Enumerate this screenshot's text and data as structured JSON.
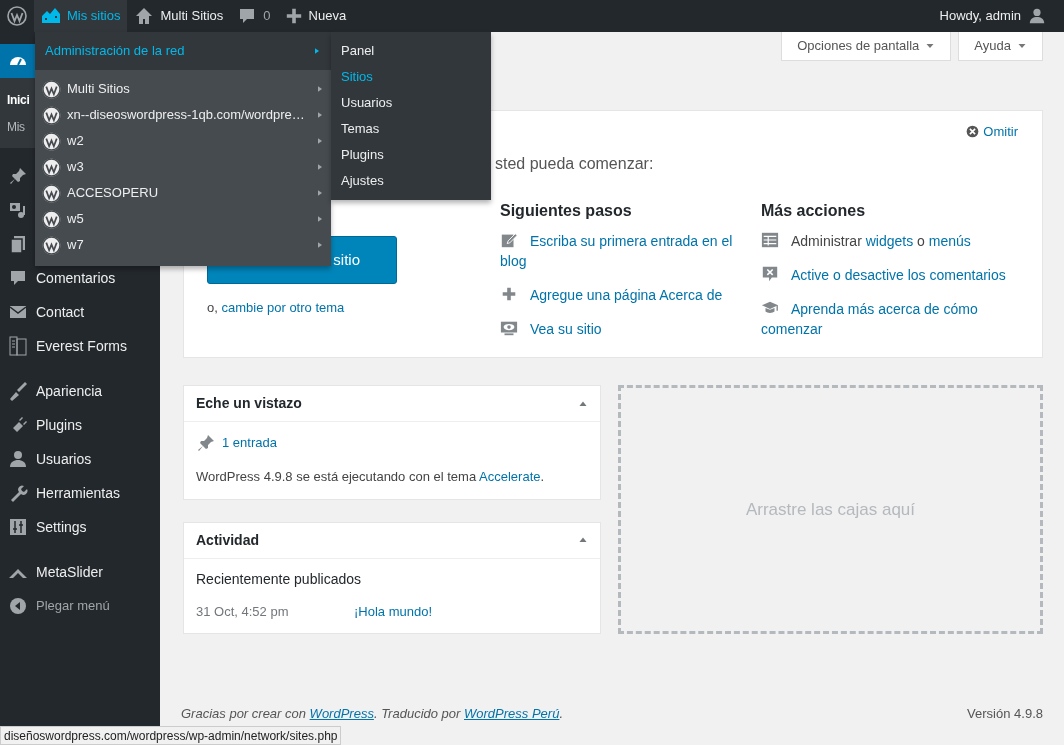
{
  "admin_bar": {
    "items": [
      {
        "kind": "wp-logo",
        "selected": false
      },
      {
        "kind": "my-sites",
        "label": "Mis sitios",
        "selected": true
      },
      {
        "kind": "site",
        "label": "Multi Sitios",
        "selected": false
      },
      {
        "kind": "comments",
        "label": "0",
        "selected": false
      },
      {
        "kind": "new",
        "label": "Nueva",
        "selected": false
      }
    ],
    "account": "Howdy, admin"
  },
  "my_sites_menu": {
    "network": {
      "label": "Administración de la red",
      "selected": true
    },
    "sites": [
      {
        "label": "Multi Sitios"
      },
      {
        "label": "xn--diseoswordpress-1qb.com/wordpre…"
      },
      {
        "label": "w2"
      },
      {
        "label": "w3"
      },
      {
        "label": "ACCESOPERU"
      },
      {
        "label": "w5"
      },
      {
        "label": "w7"
      }
    ],
    "network_submenu": [
      {
        "label": "Panel",
        "selected": false
      },
      {
        "label": "Sitios",
        "selected": true
      },
      {
        "label": "Usuarios",
        "selected": false
      },
      {
        "label": "Temas",
        "selected": false
      },
      {
        "label": "Plugins",
        "selected": false
      },
      {
        "label": "Ajustes",
        "selected": false
      }
    ]
  },
  "sidebar": {
    "groups": [
      [
        {
          "selected": true,
          "submenu": [
            {
              "label": "Inici",
              "selected": true
            },
            {
              "label": "Mis",
              "selected": false
            }
          ]
        }
      ],
      [
        {
          "selected": false
        },
        {
          "selected": false
        },
        {
          "selected": false
        },
        {
          "label": "Comentarios",
          "selected": false
        },
        {
          "label": "Contact",
          "selected": false
        },
        {
          "label": "Everest Forms",
          "selected": false
        }
      ],
      [
        {
          "label": "Apariencia",
          "selected": false
        },
        {
          "label": "Plugins",
          "selected": false
        },
        {
          "label": "Usuarios",
          "selected": false
        },
        {
          "label": "Herramientas",
          "selected": false
        },
        {
          "label": "Settings",
          "selected": false
        }
      ],
      [
        {
          "label": "MetaSlider",
          "selected": false
        }
      ]
    ],
    "collapse": "Plegar menú"
  },
  "screen_buttons": [
    "Opciones de pantalla",
    "Ayuda"
  ],
  "welcome": {
    "intro": "sted pueda comenzar:",
    "dismiss": "Omitir",
    "button": "sitio",
    "alt_prefix": "o, ",
    "alt_link": "cambie por otro tema",
    "columns": [
      {
        "title": "Siguientes pasos",
        "items": [
          {
            "parts": [
              {
                "text": "Escriba su primera entrada en el blog",
                "link": true
              }
            ]
          },
          {
            "parts": [
              {
                "text": "Agregue una página Acerca de",
                "link": true
              }
            ]
          },
          {
            "parts": [
              {
                "text": "Vea su sitio",
                "link": true
              }
            ]
          }
        ]
      },
      {
        "title": "Más acciones",
        "items": [
          {
            "parts": [
              {
                "text": "Administrar ",
                "link": false
              },
              {
                "text": "widgets",
                "link": true
              },
              {
                "text": " o ",
                "link": false
              },
              {
                "text": "menús",
                "link": true
              }
            ]
          },
          {
            "parts": [
              {
                "text": "Active o desactive los comentarios",
                "link": true
              }
            ]
          },
          {
            "parts": [
              {
                "text": "Aprenda más acerca de cómo comenzar",
                "link": true
              }
            ]
          }
        ]
      }
    ]
  },
  "glance": {
    "title": "Eche un vistazo",
    "posts": "1 entrada",
    "version_text": "WordPress 4.9.8 se está ejecutando con el tema ",
    "theme_link": "Accelerate",
    "version_end": "."
  },
  "activity": {
    "title": "Actividad",
    "heading": "Recientemente publicados",
    "rows": [
      {
        "date": "31 Oct, 4:52 pm",
        "title": "¡Hola mundo!"
      }
    ]
  },
  "drop_zone": "Arrastre las cajas aquí",
  "footer": {
    "parts": [
      {
        "text": "Gracias por crear con ",
        "link": false
      },
      {
        "text": "WordPress",
        "link": true
      },
      {
        "text": ". Traducido por ",
        "link": false
      },
      {
        "text": "WordPress Perú",
        "link": true
      },
      {
        "text": ".",
        "link": false
      }
    ],
    "version": "Versión 4.9.8"
  },
  "status_url": "diseñoswordpress.com/wordpress/wp-admin/network/sites.php"
}
